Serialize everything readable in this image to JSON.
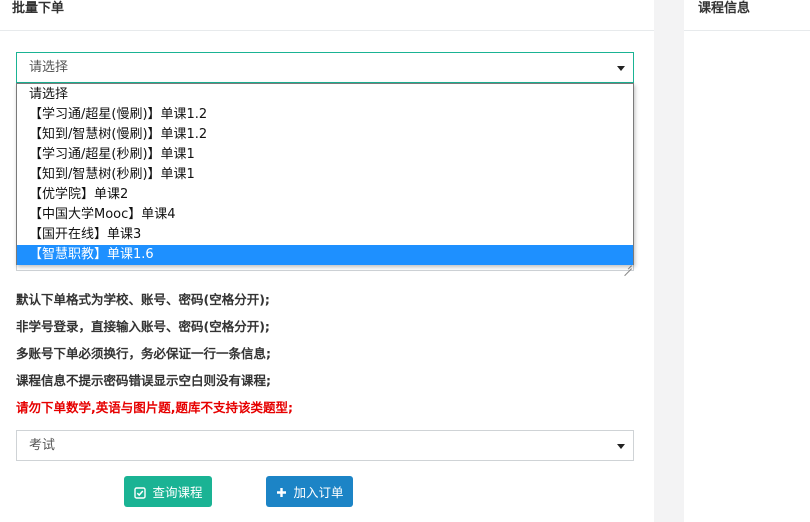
{
  "main_panel": {
    "title": "批量下单"
  },
  "right_panel": {
    "title": "课程信息"
  },
  "platform_select": {
    "value": "请选择",
    "options": [
      "请选择",
      "【学习通/超星(慢刷)】单课1.2",
      "【知到/智慧树(慢刷)】单课1.2",
      "【学习通/超星(秒刷)】单课1",
      "【知到/智慧树(秒刷)】单课1",
      "【优学院】单课2",
      "【中国大学Mooc】单课4",
      "【国开在线】单课3",
      "【智慧职教】单课1.6"
    ],
    "highlighted_index": 8
  },
  "notes": [
    "默认下单格式为学校、账号、密码(空格分开);",
    "非学号登录，直接输入账号、密码(空格分开);",
    "多账号下单必须换行，务必保证一行一条信息;",
    "课程信息不提示密码错误显示空白则没有课程;",
    "请勿下单数学,英语与图片题,题库不支持该类题型;"
  ],
  "mode_select": {
    "value": "考试"
  },
  "buttons": {
    "query_label": "查询课程",
    "add_label": "加入订单"
  },
  "colors": {
    "primary_green": "#1ab394",
    "primary_blue": "#1c84c6",
    "highlight": "#1e90ff",
    "warning_red": "#e60000"
  }
}
